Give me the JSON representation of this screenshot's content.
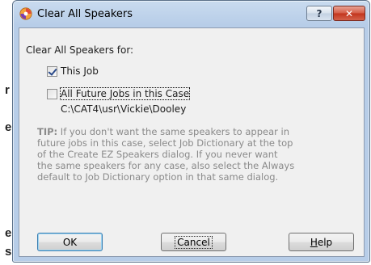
{
  "background": {
    "frag1": "r",
    "frag2": "e",
    "frag3": "e",
    "frag4": "s"
  },
  "window": {
    "title": "Clear All Speakers",
    "help_glyph": "?",
    "close_glyph": "✕"
  },
  "form": {
    "heading": "Clear All Speakers for:",
    "this_job": {
      "label": "This Job",
      "checked": true
    },
    "future_jobs": {
      "label": "All Future Jobs in this Case",
      "checked": false
    },
    "path": "C:\\CAT4\\usr\\Vickie\\Dooley",
    "tip_prefix": "TIP:",
    "tip_text": " If you don't want the same speakers to appear in\nfuture jobs in this case, select Job Dictionary at the top\nof the Create EZ Speakers dialog.  If you never want\nthe same speakers for any case, also select the Always\ndefault to Job Dictionary option in that same dialog."
  },
  "buttons": {
    "ok": "OK",
    "cancel": "Cancel",
    "help_first": "H",
    "help_rest": "elp"
  }
}
